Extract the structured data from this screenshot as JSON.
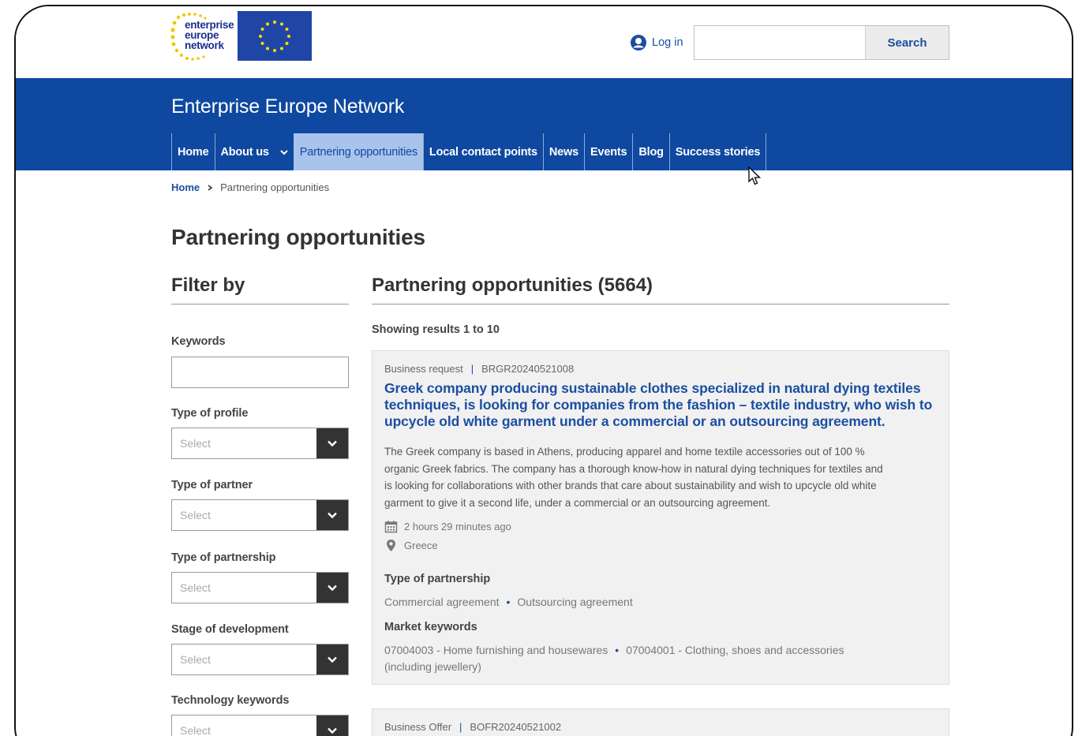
{
  "header": {
    "logo_lines": [
      "enterprise",
      "europe",
      "network"
    ],
    "login_label": "Log in",
    "search_placeholder": "",
    "search_button": "Search"
  },
  "banner": {
    "site_title": "Enterprise Europe Network",
    "nav": [
      {
        "label": "Home"
      },
      {
        "label": "About us"
      },
      {
        "label": "Partnering opportunities",
        "active": true
      },
      {
        "label": "Local contact points"
      },
      {
        "label": "News"
      },
      {
        "label": "Events"
      },
      {
        "label": "Blog"
      },
      {
        "label": "Success stories"
      }
    ]
  },
  "breadcrumb": {
    "home": "Home",
    "current": "Partnering opportunities"
  },
  "page_title": "Partnering opportunities",
  "filter": {
    "title": "Filter by",
    "keywords_label": "Keywords",
    "keywords_value": "",
    "selects": [
      {
        "label": "Type of profile",
        "value": "Select"
      },
      {
        "label": "Type of partner",
        "value": "Select"
      },
      {
        "label": "Type of partnership",
        "value": "Select"
      },
      {
        "label": "Stage of development",
        "value": "Select"
      },
      {
        "label": "Technology keywords",
        "value": "Select"
      }
    ]
  },
  "results": {
    "title": "Partnering opportunities (5664)",
    "showing": "Showing results 1 to 10",
    "cards": [
      {
        "type": "Business request",
        "ref": "BRGR20240521008",
        "title": "Greek company producing sustainable clothes specialized in natural dying textiles techniques, is looking for companies from the fashion – textile industry, who wish to upcycle old white garment under a commercial or an outsourcing agreement.",
        "description": "The Greek company is based in Athens, producing apparel and home textile accessories out of 100 % organic Greek fabrics. The company has a thorough know-how in natural dying techniques for textiles and is looking for collaborations with other brands that care about sustainability and wish to upcycle old white garment to give it a second life, under a commercial or an outsourcing agreement.",
        "time": "2 hours 29 minutes ago",
        "location": "Greece",
        "partnership_label": "Type of partnership",
        "partnership_tags": [
          "Commercial agreement",
          "Outsourcing agreement"
        ],
        "keywords_label": "Market keywords",
        "keywords_tags": [
          "07004003 - Home furnishing and housewares",
          "07004001 - Clothing, shoes and accessories (including jewellery)"
        ]
      },
      {
        "type": "Business Offer",
        "ref": "BOFR20240521002"
      }
    ]
  },
  "colors": {
    "primary_blue": "#0e48a0",
    "active_tab": "#a9c4ec",
    "link_blue": "#1b4ea0"
  }
}
